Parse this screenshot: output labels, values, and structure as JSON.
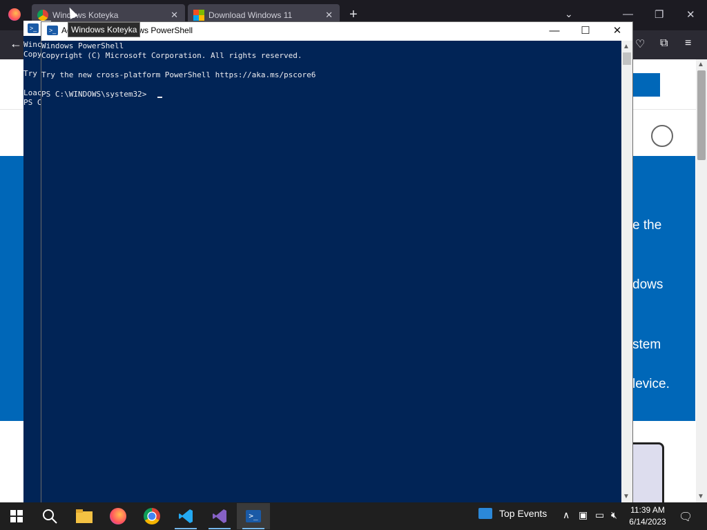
{
  "firefox": {
    "tabs": [
      {
        "label": "Windows Koteyka"
      },
      {
        "label": "Download Windows 11"
      }
    ]
  },
  "page": {
    "hero_lines": [
      "e the",
      "dows",
      "stem",
      "levice."
    ]
  },
  "background_ps": {
    "lines": [
      "Winc",
      "Copy",
      "Try",
      "Loac",
      "PS C"
    ]
  },
  "powershell": {
    "title": "Administrator: Windows PowerShell",
    "lines": [
      "Windows PowerShell",
      "Copyright (C) Microsoft Corporation. All rights reserved.",
      "",
      "Try the new cross-platform PowerShell https://aka.ms/pscore6",
      "",
      "PS C:\\WINDOWS\\system32> "
    ]
  },
  "tooltip": {
    "text": "Windows Koteyka"
  },
  "taskbar": {
    "apps": [
      "Start",
      "Search",
      "File Explorer",
      "Firefox",
      "Chrome",
      "Visual Studio Code",
      "Visual Studio",
      "Windows PowerShell"
    ],
    "news_widget": "Top Events",
    "time": "11:39 AM",
    "date": "6/14/2023"
  },
  "colors": {
    "console_bg": "#012456",
    "page_blue": "#0067b8"
  }
}
